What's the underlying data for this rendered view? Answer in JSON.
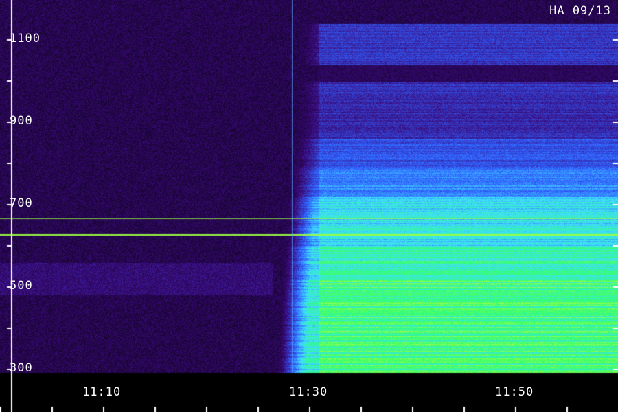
{
  "chart_data": {
    "type": "heatmap",
    "title": "HA 09/13",
    "xlabel": "",
    "ylabel": "",
    "x_tick_labels": [
      "11:10",
      "11:30",
      "11:50"
    ],
    "y_tick_labels": [
      "1100",
      "900",
      "700",
      "500",
      "300"
    ],
    "y_ticks": [
      1100,
      900,
      700,
      500,
      300
    ],
    "ylim": [
      280,
      1270
    ],
    "x_ticks_minutes": [
      10,
      30,
      50
    ],
    "xlim_minutes": [
      0,
      59
    ],
    "colormap": [
      "#000000",
      "#3a0a7a",
      "#3060ff",
      "#40e0ff",
      "#30ff70",
      "#d8ff30"
    ],
    "events": [
      {
        "start_minute": 26.5,
        "broadband_onset_minute": 31,
        "end_minute": 59,
        "freq_range": [
          295,
          1140
        ],
        "peak_freq_range": [
          295,
          700
        ]
      }
    ],
    "interference_lines_freq": [
      666,
      629
    ],
    "vertical_spike_minute": 28.3,
    "background_emission_band": [
      480,
      560
    ]
  }
}
